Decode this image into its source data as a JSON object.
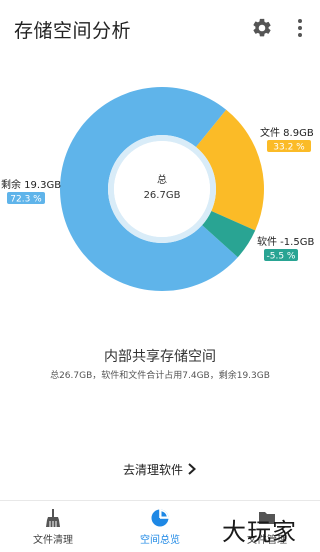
{
  "header": {
    "title": "存储空间分析",
    "settings_icon": "gear-icon",
    "more_icon": "more-vert-icon"
  },
  "chart_data": {
    "type": "pie",
    "center_label": "总",
    "center_value": "26.7GB",
    "slices": [
      {
        "name": "剩余",
        "size_label": "剩余 19.3GB",
        "percent": 72.3,
        "percent_label": "72.3 %",
        "color": "#5fb4ea"
      },
      {
        "name": "文件",
        "size_label": "文件 8.9GB",
        "percent": 33.2,
        "percent_label": "33.2 %",
        "color": "#fbbb27"
      },
      {
        "name": "软件",
        "size_label": "软件 -1.5GB",
        "percent": 5.5,
        "percent_label": "-5.5 %",
        "color": "#29a493"
      }
    ]
  },
  "summary": {
    "title": "内部共享存储空间",
    "subtitle": "总26.7GB，软件和文件合计占用7.4GB，剩余19.3GB"
  },
  "clean_button": {
    "label": "去清理软件"
  },
  "bottom_nav": {
    "items": [
      {
        "label": "文件清理",
        "icon": "broom-icon",
        "active": false
      },
      {
        "label": "空间总览",
        "icon": "pie-chart-icon",
        "active": true
      },
      {
        "label": "文件管理",
        "icon": "folder-icon",
        "active": false
      }
    ]
  },
  "watermark": {
    "text": "大玩家"
  },
  "colors": {
    "accent": "#1e88e5"
  }
}
